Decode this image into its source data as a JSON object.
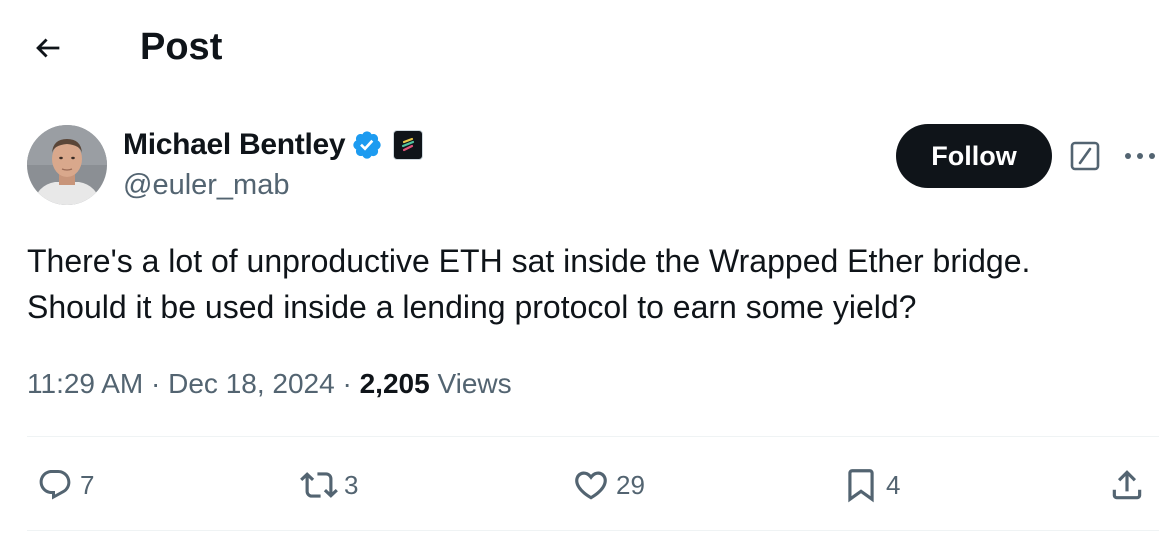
{
  "header": {
    "title": "Post"
  },
  "author": {
    "name": "Michael Bentley",
    "handle": "@euler_mab"
  },
  "follow_label": "Follow",
  "tweet": {
    "lines": [
      "There's a lot of unproductive ETH sat inside the Wrapped Ether bridge.",
      "Should it be used inside a lending protocol to earn some yield?"
    ]
  },
  "meta": {
    "time": "11:29 AM",
    "separator": "·",
    "date": "Dec 18, 2024",
    "views_count": "2,205",
    "views_label": "Views"
  },
  "actions": {
    "replies": "7",
    "reposts": "3",
    "likes": "29",
    "bookmarks": "4"
  },
  "icons": [
    "back-arrow-icon",
    "verified-badge-icon",
    "affiliate-badge-icon",
    "grok-icon",
    "more-icon",
    "reply-icon",
    "repost-icon",
    "like-icon",
    "bookmark-icon",
    "share-icon"
  ],
  "colors": {
    "text": "#0f1419",
    "secondary": "#536471",
    "verified": "#1d9bf0",
    "follow_bg": "#0f1419",
    "divider": "#eff3f4"
  }
}
